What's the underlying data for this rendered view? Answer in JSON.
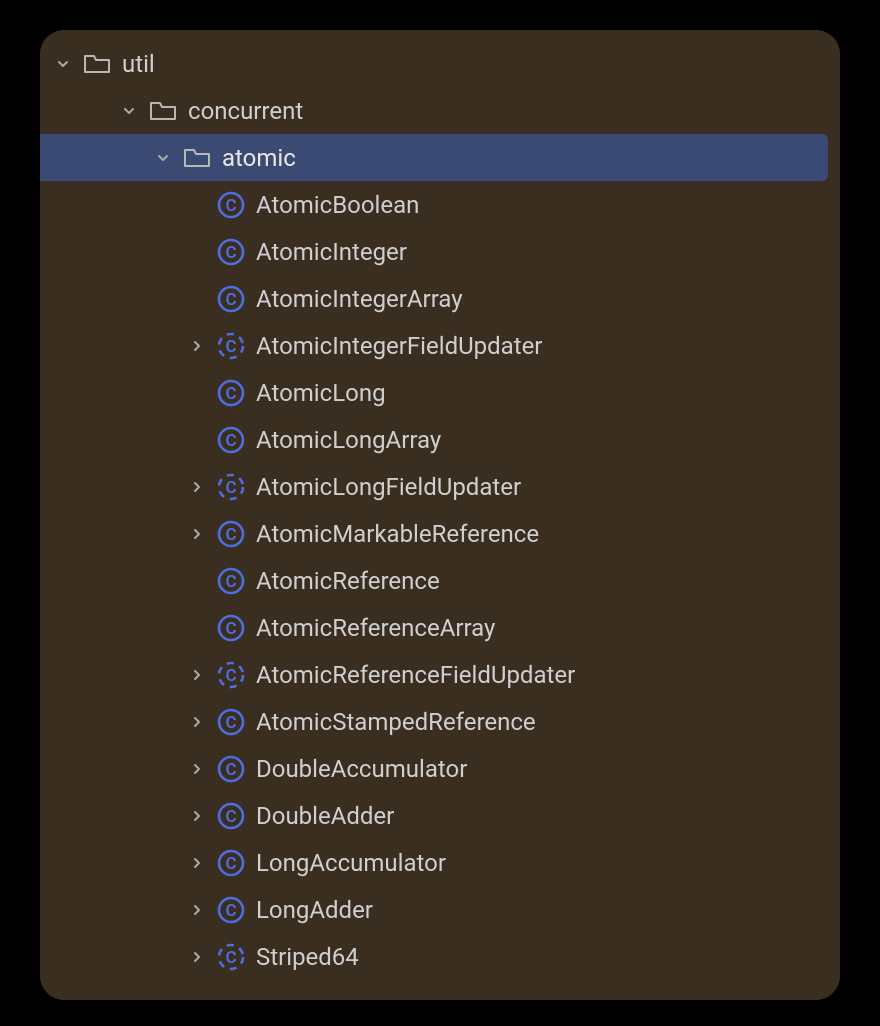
{
  "colors": {
    "background": "#3a2e20",
    "selection": "#3b4a73",
    "classIcon": "#4e6de0",
    "text": "#cfcfcf"
  },
  "tree": {
    "root": {
      "label": "util",
      "children": {
        "concurrent": {
          "label": "concurrent",
          "children": {
            "atomic": {
              "label": "atomic",
              "items": [
                {
                  "label": "AtomicBoolean",
                  "expandable": false,
                  "abstract": false
                },
                {
                  "label": "AtomicInteger",
                  "expandable": false,
                  "abstract": false
                },
                {
                  "label": "AtomicIntegerArray",
                  "expandable": false,
                  "abstract": false
                },
                {
                  "label": "AtomicIntegerFieldUpdater",
                  "expandable": true,
                  "abstract": true
                },
                {
                  "label": "AtomicLong",
                  "expandable": false,
                  "abstract": false
                },
                {
                  "label": "AtomicLongArray",
                  "expandable": false,
                  "abstract": false
                },
                {
                  "label": "AtomicLongFieldUpdater",
                  "expandable": true,
                  "abstract": true
                },
                {
                  "label": "AtomicMarkableReference",
                  "expandable": true,
                  "abstract": false
                },
                {
                  "label": "AtomicReference",
                  "expandable": false,
                  "abstract": false
                },
                {
                  "label": "AtomicReferenceArray",
                  "expandable": false,
                  "abstract": false
                },
                {
                  "label": "AtomicReferenceFieldUpdater",
                  "expandable": true,
                  "abstract": true
                },
                {
                  "label": "AtomicStampedReference",
                  "expandable": true,
                  "abstract": false
                },
                {
                  "label": "DoubleAccumulator",
                  "expandable": true,
                  "abstract": false
                },
                {
                  "label": "DoubleAdder",
                  "expandable": true,
                  "abstract": false
                },
                {
                  "label": "LongAccumulator",
                  "expandable": true,
                  "abstract": false
                },
                {
                  "label": "LongAdder",
                  "expandable": true,
                  "abstract": false
                },
                {
                  "label": "Striped64",
                  "expandable": true,
                  "abstract": true
                }
              ]
            }
          }
        }
      }
    }
  }
}
